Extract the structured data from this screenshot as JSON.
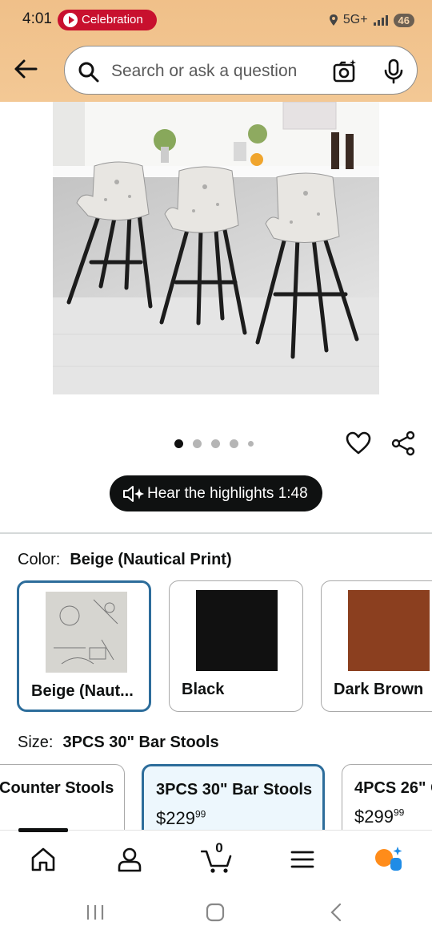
{
  "status_bar": {
    "time": "4:01",
    "notification_pill": "Celebration",
    "network": "5G+",
    "battery": "46"
  },
  "search": {
    "placeholder": "Search or ask a question"
  },
  "gallery": {
    "dot_count": 5,
    "active_index": 0
  },
  "audio": {
    "label": "Hear the highlights 1:48"
  },
  "color": {
    "label": "Color:",
    "selected": "Beige (Nautical Print)",
    "options": [
      {
        "name": "Beige (Naut...",
        "swatch": "#d9d9d4"
      },
      {
        "name": "Black",
        "swatch": "#111111"
      },
      {
        "name": "Dark Brown",
        "swatch": "#8b3f1f"
      }
    ]
  },
  "size": {
    "label": "Size:",
    "selected": "3PCS 30\" Bar Stools",
    "options": [
      {
        "name": "Counter Stools",
        "price_whole": "",
        "price_cents": ""
      },
      {
        "name": "3PCS 30\" Bar Stools",
        "price_whole": "$229",
        "price_cents": "99"
      },
      {
        "name": "4PCS 26\" C",
        "price_whole": "$299",
        "price_cents": "99"
      }
    ]
  },
  "bottom_nav": {
    "cart_count": "0"
  },
  "colors": {
    "header": "#f0c089",
    "selected_border": "#2d6d9b",
    "pill_red": "#c8102e"
  }
}
